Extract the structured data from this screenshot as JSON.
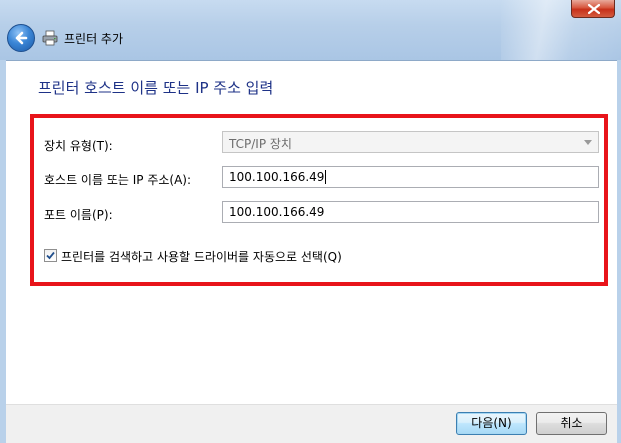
{
  "window": {
    "title": "프린터 추가",
    "close_icon": "close-icon",
    "back_icon": "back-arrow-icon",
    "app_icon": "printer-icon"
  },
  "page": {
    "heading": "프린터 호스트 이름 또는 IP 주소 입력"
  },
  "form": {
    "device_type": {
      "label": "장치 유형(T):",
      "value": "TCP/IP 장치"
    },
    "host": {
      "label": "호스트 이름 또는 IP 주소(A):",
      "value": "100.100.166.49"
    },
    "port": {
      "label": "포트 이름(P):",
      "value": "100.100.166.49"
    },
    "auto_driver": {
      "label": "프린터를 검색하고 사용할 드라이버를 자동으로 선택(Q)",
      "checked": true
    }
  },
  "buttons": {
    "next": "다음(N)",
    "cancel": "취소"
  },
  "colors": {
    "highlight": "#e8141a",
    "heading": "#1e3287"
  }
}
